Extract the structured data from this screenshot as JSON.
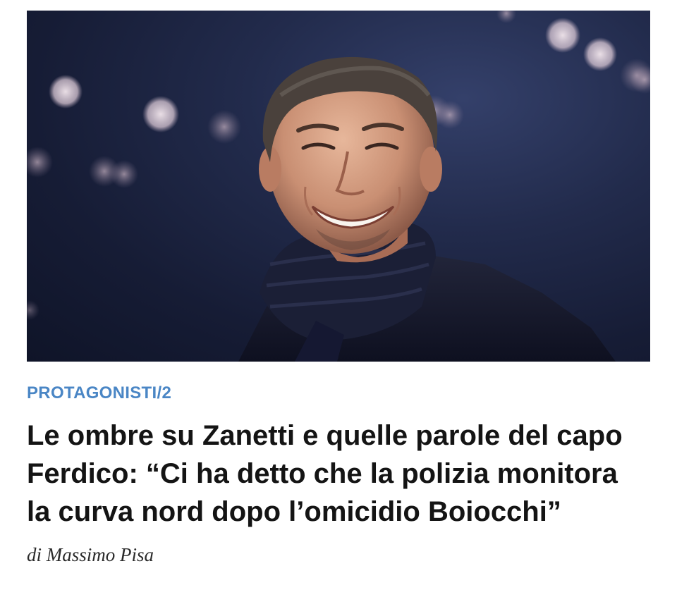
{
  "article": {
    "image_alt": "Javier Zanetti sorridente allo stadio",
    "kicker": "PROTAGONISTI/2",
    "headline": "Le ombre su Zanetti e quelle parole del capo Ferdico: “Ci ha detto che la polizia monitora la curva nord dopo l’omicidio Boiocchi”",
    "byline": "di Massimo Pisa"
  }
}
